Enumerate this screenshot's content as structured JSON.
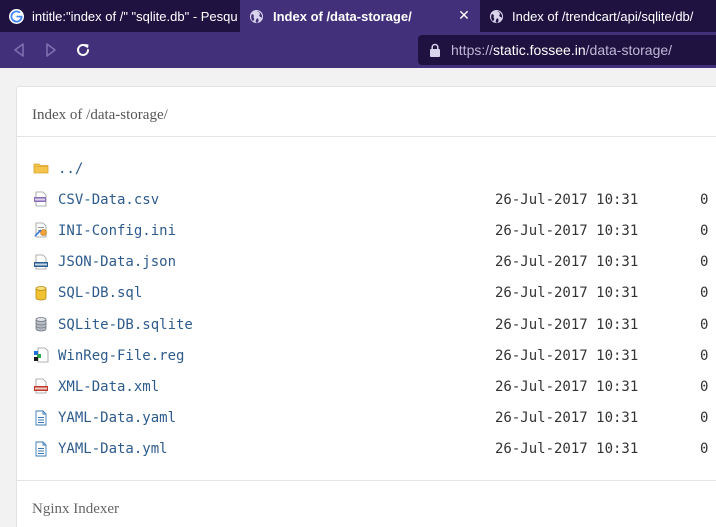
{
  "browser": {
    "tabs": [
      {
        "title": "intitle:\"index of /\" \"sqlite.db\" - Pesquisa Google",
        "favicon": "google-icon",
        "active": false
      },
      {
        "title": "Index of /data-storage/",
        "favicon": "globe-icon",
        "active": true,
        "close": "✕"
      },
      {
        "title": "Index of /trendcart/api/sqlite/db/",
        "favicon": "globe-icon",
        "active": false
      }
    ],
    "url": {
      "scheme": "https://",
      "host": "static.fossee.in",
      "path": "/data-storage/"
    },
    "colors": {
      "tabstrip": "#1f1240",
      "active_tab": "#42307a",
      "toolbar": "#42307a",
      "urlbar": "#1f1240"
    }
  },
  "page": {
    "heading": "Index of /data-storage/",
    "footer": "Nginx Indexer",
    "link_color": "#2e5b8c",
    "entries": [
      {
        "name": "../",
        "date": "",
        "size": "",
        "icon": "folder-icon"
      },
      {
        "name": "CSV-Data.csv",
        "date": "26-Jul-2017 10:31",
        "size": "0",
        "icon": "csv-file-icon"
      },
      {
        "name": "INI-Config.ini",
        "date": "26-Jul-2017 10:31",
        "size": "0",
        "icon": "ini-file-icon"
      },
      {
        "name": "JSON-Data.json",
        "date": "26-Jul-2017 10:31",
        "size": "0",
        "icon": "json-file-icon"
      },
      {
        "name": "SQL-DB.sql",
        "date": "26-Jul-2017 10:31",
        "size": "0",
        "icon": "database-icon"
      },
      {
        "name": "SQLite-DB.sqlite",
        "date": "26-Jul-2017 10:31",
        "size": "0",
        "icon": "sqlite-database-icon"
      },
      {
        "name": "WinReg-File.reg",
        "date": "26-Jul-2017 10:31",
        "size": "0",
        "icon": "registry-file-icon"
      },
      {
        "name": "XML-Data.xml",
        "date": "26-Jul-2017 10:31",
        "size": "0",
        "icon": "xml-file-icon"
      },
      {
        "name": "YAML-Data.yaml",
        "date": "26-Jul-2017 10:31",
        "size": "0",
        "icon": "text-file-icon"
      },
      {
        "name": "YAML-Data.yml",
        "date": "26-Jul-2017 10:31",
        "size": "0",
        "icon": "text-file-icon"
      }
    ]
  }
}
